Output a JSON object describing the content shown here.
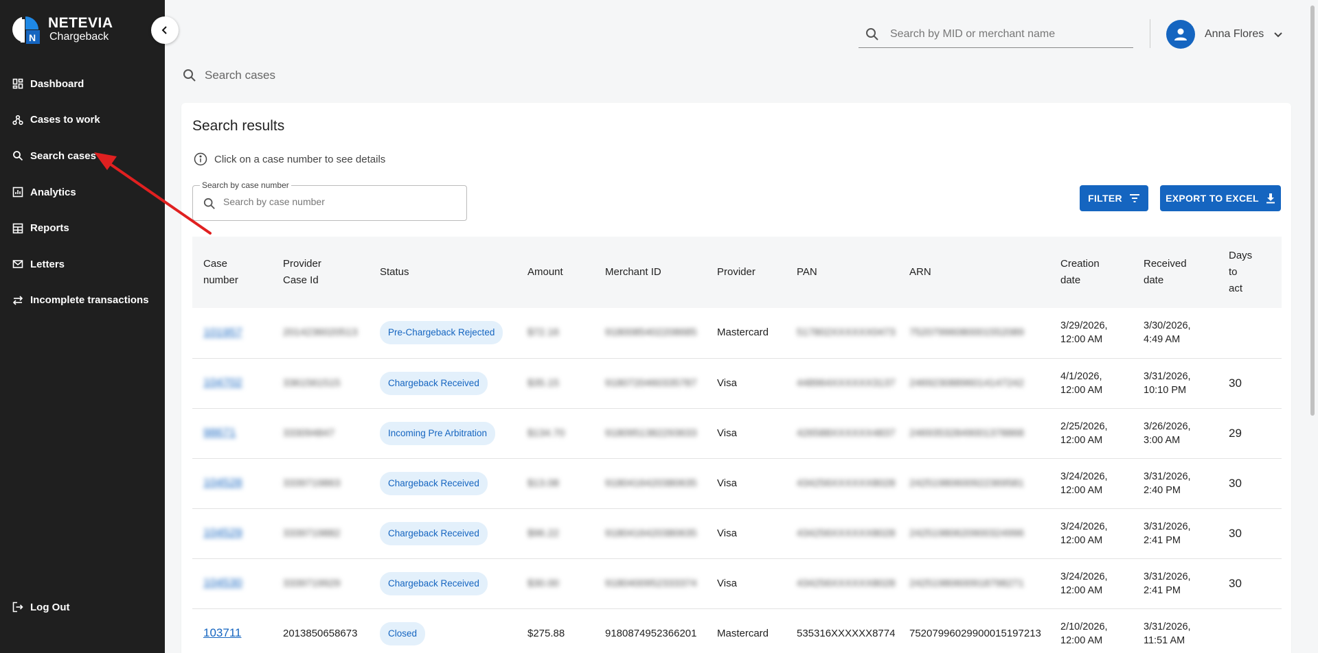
{
  "brand": {
    "name": "NETEVIA",
    "product": "Chargeback"
  },
  "sidebar": {
    "items": [
      {
        "label": "Dashboard",
        "icon": "dashboard-icon"
      },
      {
        "label": "Cases to work",
        "icon": "workflow-icon"
      },
      {
        "label": "Search cases",
        "icon": "search-icon"
      },
      {
        "label": "Analytics",
        "icon": "analytics-icon"
      },
      {
        "label": "Reports",
        "icon": "reports-icon"
      },
      {
        "label": "Letters",
        "icon": "mail-icon"
      },
      {
        "label": "Incomplete transactions",
        "icon": "swap-icon"
      }
    ],
    "logout": "Log Out"
  },
  "header": {
    "search_placeholder": "Search by MID or merchant name",
    "user_name": "Anna Flores"
  },
  "page": {
    "search_label": "Search cases"
  },
  "results": {
    "title": "Search results",
    "hint": "Click on a case number to see details",
    "case_search_label": "Search by case number",
    "case_search_placeholder": "Search by case number",
    "filter_label": "FILTER",
    "export_label": "EXPORT TO EXCEL",
    "columns": {
      "case_line1": "Case",
      "case_line2": "number",
      "provider_line1": "Provider",
      "provider_line2": "Case Id",
      "status": "Status",
      "amount": "Amount",
      "merchant": "Merchant ID",
      "provider": "Provider",
      "pan": "PAN",
      "arn": "ARN",
      "created_line1": "Creation",
      "created_line2": "date",
      "received_line1": "Received",
      "received_line2": "date",
      "days_line1": "Days",
      "days_line2": "to",
      "days_line3": "act"
    },
    "rows": [
      {
        "case": "101957",
        "provider_case": "2014236020513",
        "status": "Pre-Chargeback Rejected",
        "amount": "$72.16",
        "merchant": "9180085402208685",
        "provider": "Mastercard",
        "pan": "517802XXXXXX0473",
        "arn": "75207996080001552089",
        "created_date": "3/29/2026,",
        "created_time": "12:00 AM",
        "received_date": "3/30/2026,",
        "received_time": "4:49 AM",
        "days": ""
      },
      {
        "case": "104702",
        "provider_case": "3361561515",
        "status": "Chargeback Received",
        "amount": "$35.15",
        "merchant": "9180720460335787",
        "provider": "Visa",
        "pan": "448964XXXXXX3137",
        "arn": "24692308896014147242",
        "created_date": "4/1/2026,",
        "created_time": "12:00 AM",
        "received_date": "3/31/2026,",
        "received_time": "10:10 PM",
        "days": "30"
      },
      {
        "case": "98671",
        "provider_case": "333094847",
        "status": "Incoming Pre Arbitration",
        "amount": "$134.70",
        "merchant": "9180951382293633",
        "provider": "Visa",
        "pan": "426588XXXXXX4837",
        "arn": "24693532849001378868",
        "created_date": "2/25/2026,",
        "created_time": "12:00 AM",
        "received_date": "3/26/2026,",
        "received_time": "3:00 AM",
        "days": "29"
      },
      {
        "case": "104528",
        "provider_case": "3339719863",
        "status": "Chargeback Received",
        "amount": "$13.08",
        "merchant": "9180416420380635",
        "provider": "Visa",
        "pan": "434256XXXXXX8028",
        "arn": "24251980600922369581",
        "created_date": "3/24/2026,",
        "created_time": "12:00 AM",
        "received_date": "3/31/2026,",
        "received_time": "2:40 PM",
        "days": "30"
      },
      {
        "case": "104529",
        "provider_case": "3339719882",
        "status": "Chargeback Received",
        "amount": "$96.22",
        "merchant": "9180416420380635",
        "provider": "Visa",
        "pan": "434256XXXXXX8028",
        "arn": "24251980620900324996",
        "created_date": "3/24/2026,",
        "created_time": "12:00 AM",
        "received_date": "3/31/2026,",
        "received_time": "2:41 PM",
        "days": "30"
      },
      {
        "case": "104530",
        "provider_case": "3339719929",
        "status": "Chargeback Received",
        "amount": "$30.00",
        "merchant": "9180400952333374",
        "provider": "Visa",
        "pan": "434256XXXXXX8028",
        "arn": "24251980600918798271",
        "created_date": "3/24/2026,",
        "created_time": "12:00 AM",
        "received_date": "3/31/2026,",
        "received_time": "2:41 PM",
        "days": "30"
      },
      {
        "case": "103711",
        "provider_case": "2013850658673",
        "status": "Closed",
        "amount": "$275.88",
        "merchant": "9180874952366201",
        "provider": "Mastercard",
        "pan": "535316XXXXXX8774",
        "arn": "75207996029900015197213",
        "created_date": "2/10/2026,",
        "created_time": "12:00 AM",
        "received_date": "3/31/2026,",
        "received_time": "11:51 AM",
        "days": ""
      }
    ]
  },
  "colors": {
    "sidebar": "#1f1f1f",
    "accent": "#1565c0",
    "chip_bg": "#e3f0fb",
    "arrow": "#e02020"
  }
}
